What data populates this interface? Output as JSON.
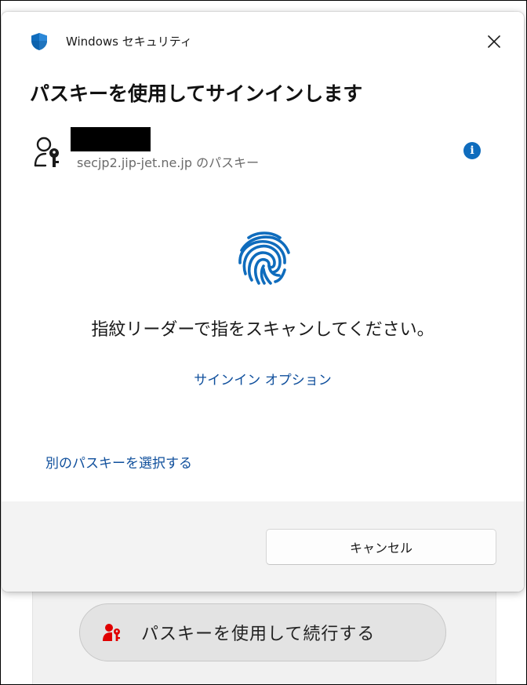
{
  "dialog": {
    "app_title": "Windows セキュリティ",
    "heading": "パスキーを使用してサインインします",
    "account": {
      "subtitle": "secjp2.jip-jet.ne.jp のパスキー"
    },
    "info_label": "i",
    "instruction": "指紋リーダーで指をスキャンしてください。",
    "signin_options_link": "サインイン オプション",
    "other_passkey_link": "別のパスキーを選択する",
    "cancel_label": "キャンセル"
  },
  "background_page": {
    "continue_button_label": "パスキーを使用して続行する"
  },
  "icons": {
    "app": "shield-icon",
    "close": "close-icon",
    "account": "person-key-icon",
    "info": "info-icon",
    "fingerprint": "fingerprint-icon",
    "continue": "person-key-icon"
  },
  "colors": {
    "accent_blue": "#0f6cbd",
    "link_blue": "#0f4f9c",
    "continue_icon_red": "#e00000"
  }
}
